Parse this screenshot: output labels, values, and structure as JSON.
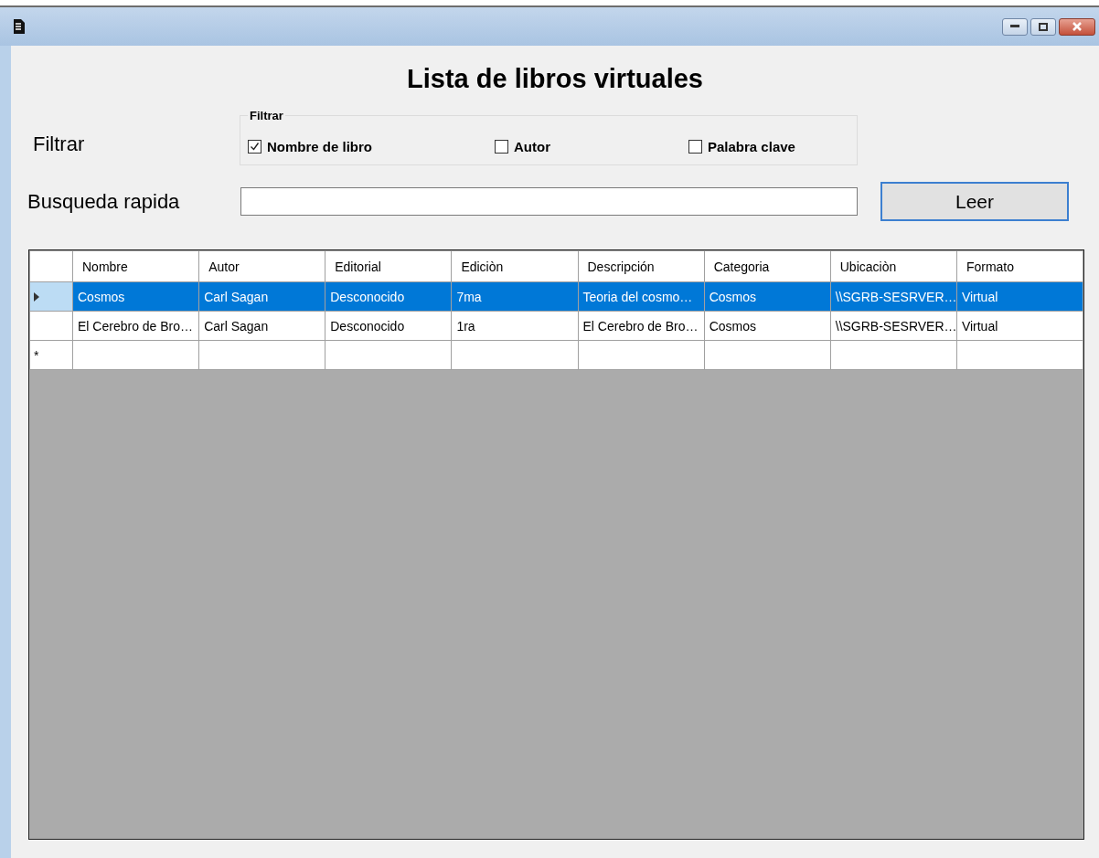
{
  "window": {
    "title": "Lista de libros virtuales"
  },
  "filter_label": "Filtrar",
  "filter_group": {
    "title": "Filtrar",
    "options": [
      {
        "label": "Nombre de libro",
        "checked": true
      },
      {
        "label": "Autor",
        "checked": false
      },
      {
        "label": "Palabra clave",
        "checked": false
      }
    ]
  },
  "quick_search": {
    "label": "Busqueda rapida"
  },
  "read_button": "Leer",
  "table": {
    "columns": [
      "Nombre",
      "Autor",
      "Editorial",
      "Ediciòn",
      "Descripción",
      "Categoria",
      "Ubicaciòn",
      "Formato"
    ],
    "rows": [
      {
        "selected": true,
        "cells": [
          "Cosmos",
          "Carl Sagan",
          "Desconocido",
          "7ma",
          "Teoria del cosmo…",
          "Cosmos",
          "\\\\SGRB-SESRVER…",
          "Virtual"
        ]
      },
      {
        "selected": false,
        "cells": [
          "El Cerebro de Bro…",
          "Carl Sagan",
          "Desconocido",
          "1ra",
          "El Cerebro de Bro…",
          "Cosmos",
          "\\\\SGRB-SESRVER…",
          "Virtual"
        ]
      }
    ],
    "new_row_marker": "*"
  }
}
